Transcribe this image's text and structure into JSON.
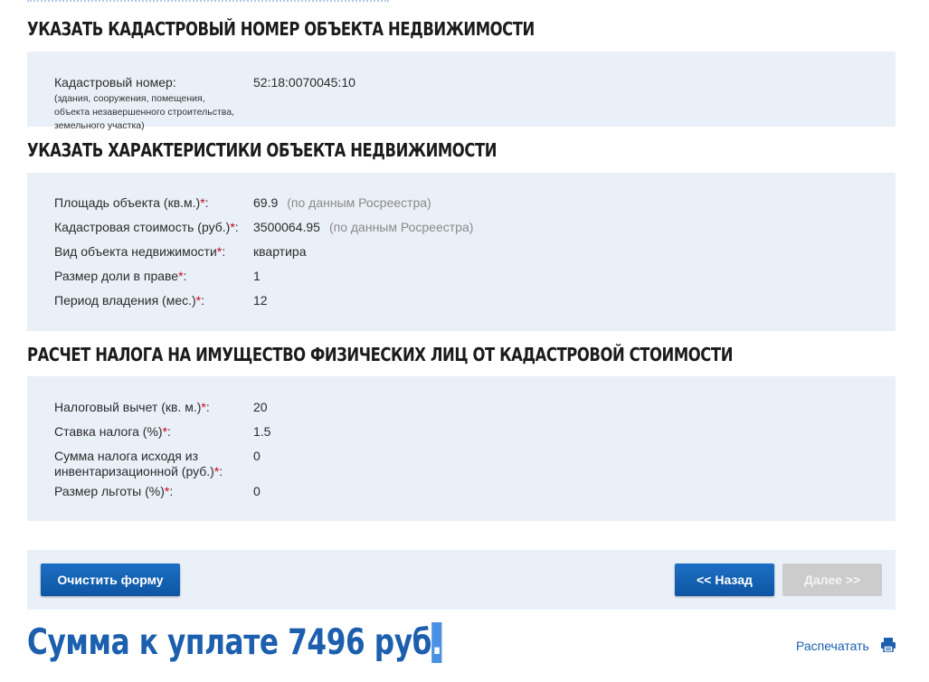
{
  "sections": {
    "cadastral_title": "УКАЗАТЬ КАДАСТРОВЫЙ НОМЕР ОБЪЕКТА НЕДВИЖИМОСТИ",
    "characteristics_title": "УКАЗАТЬ ХАРАКТЕРИСТИКИ ОБЪЕКТА НЕДВИЖИМОСТИ",
    "tax_title": "РАСЧЕТ НАЛОГА НА ИМУЩЕСТВО ФИЗИЧЕСКИХ ЛИЦ ОТ КАДАСТРОВОЙ СТОИМОСТИ"
  },
  "cadastral": {
    "label": "Кадастровый номер:",
    "sub1": "(здания, сооружения, помещения,",
    "sub2": "объекта незавершенного строительства,",
    "sub3": "земельного участка)",
    "value": "52:18:0070045:10"
  },
  "characteristics": {
    "area_label": "Площадь объекта (кв.м.)",
    "area_value": "69.9",
    "area_note": "(по данным Росреестра)",
    "cost_label": "Кадастровая стоимость (руб.)",
    "cost_value": "3500064.95",
    "cost_note": "(по данным Росреестра)",
    "type_label": "Вид объекта недвижимости",
    "type_value": "квартира",
    "share_label": "Размер доли в праве",
    "share_value": "1",
    "period_label": "Период владения (мес.)",
    "period_value": "12"
  },
  "tax": {
    "deduction_label": "Налоговый вычет (кв. м.)",
    "deduction_value": "20",
    "rate_label": "Ставка налога (%)",
    "rate_value": "1.5",
    "inventory_label1": "Сумма налога исходя из",
    "inventory_label2": "инвентаризационной (руб.)",
    "inventory_value": "0",
    "benefit_label": "Размер льготы (%)",
    "benefit_value": "0"
  },
  "common": {
    "required_mark": "*",
    "colon": ":"
  },
  "buttons": {
    "clear": "Очистить форму",
    "back": "<< Назад",
    "next": "Далее >>"
  },
  "result": {
    "total_text": "Сумма к уплате 7496 руб",
    "cursor_char": ".",
    "print_link": "Распечатать"
  },
  "colors": {
    "accent": "#1c5fae",
    "panel": "#eaf0f8",
    "required": "#d0021b",
    "disabled": "#cccccc"
  }
}
